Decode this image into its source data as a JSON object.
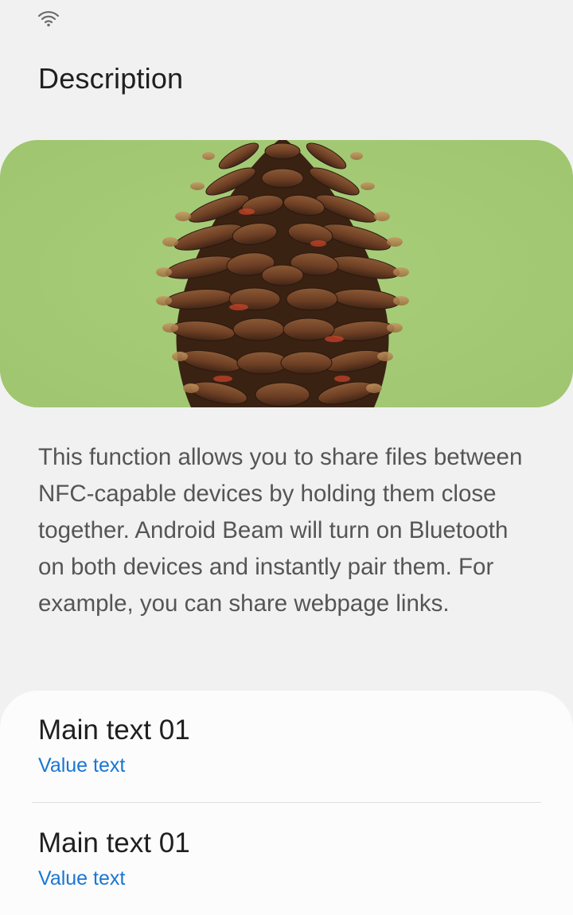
{
  "status_bar": {
    "wifi_icon": "wifi-icon"
  },
  "page": {
    "title": "Description"
  },
  "hero": {
    "subject": "pinecone-photo",
    "background_color": "#a4c974"
  },
  "description": {
    "text": "This function allows you to share files between NFC-capable devices by holding them close together. Android Beam will turn on Bluetooth on both devices and instantly pair them. For example, you can share webpage links."
  },
  "list": {
    "items": [
      {
        "main": "Main text 01",
        "value": "Value text"
      },
      {
        "main": "Main text 01",
        "value": "Value text"
      }
    ]
  },
  "colors": {
    "accent": "#1a76d2",
    "background": "#f1f1f1",
    "card": "#fcfcfc"
  }
}
